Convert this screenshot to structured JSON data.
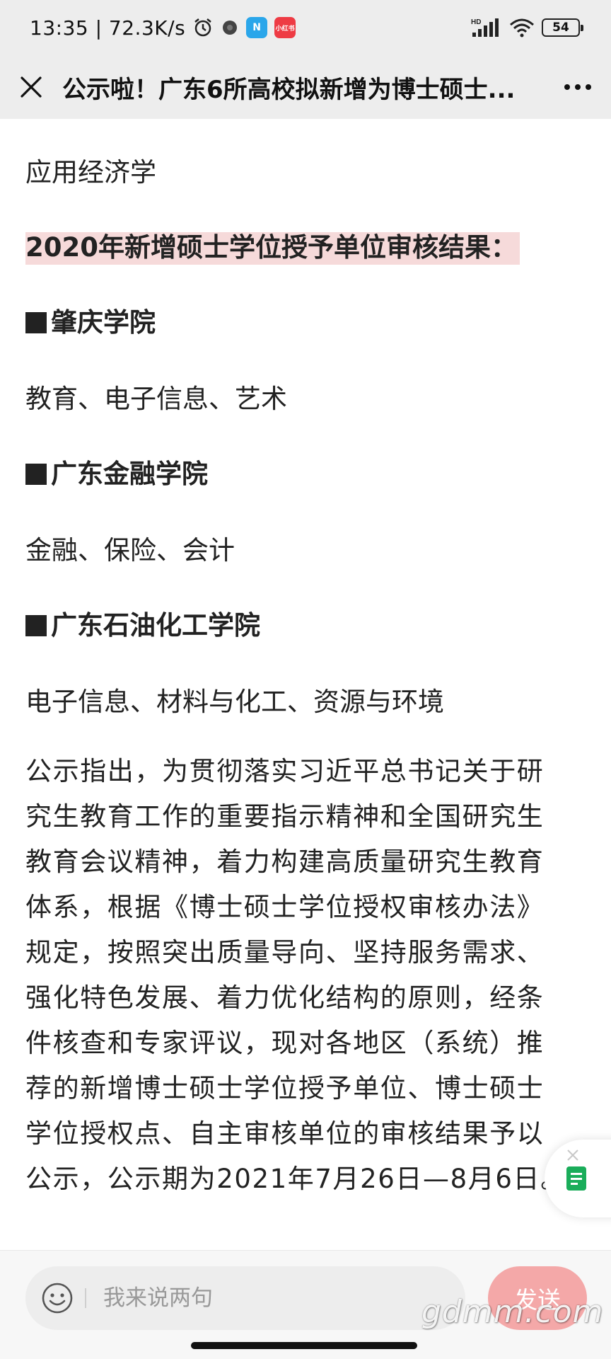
{
  "status_bar": {
    "time_speed": "13:35 | 72.3K/s",
    "app_badges": [
      {
        "label": "N",
        "color": "#2aa6ea"
      },
      {
        "label": "小红书",
        "color": "#ee3b44"
      }
    ],
    "hd_label": "HD",
    "battery": "54"
  },
  "nav": {
    "title": "公示啦！广东6所高校拟新增为博士硕士..."
  },
  "article": {
    "line1": "应用经济学",
    "heading": "2020年新增硕士学位授予单位审核结果：",
    "schools": [
      {
        "name": "肇庆学院",
        "fields": "教育、电子信息、艺术"
      },
      {
        "name": "广东金融学院",
        "fields": "金融、保险、会计"
      },
      {
        "name": "广东石油化工学院",
        "fields": "电子信息、材料与化工、资源与环境"
      }
    ],
    "body_lines": [
      "公示指出，为贯彻落实习近平总书记关于研",
      "究生教育工作的重要指示精神和全国研究生",
      "教育会议精神，着力构建高质量研究生教育",
      "体系，根据《博士硕士学位授权审核办法》",
      "规定，按照突出质量导向、坚持服务需求、",
      "强化特色发展、着力优化结构的原则，经条",
      "件核查和专家评议，现对各地区（系统）推",
      "荐的新增博士硕士学位授予单位、博士硕士",
      "学位授权点、自主审核单位的审核结果予以",
      "公示，公示期为2021年7月26日—8月6日。"
    ]
  },
  "bottom": {
    "placeholder": "我来说两句",
    "send_label": "发送"
  },
  "watermark": "gdmm.com",
  "colors": {
    "bar_bg": "#ededed",
    "highlight": "#f6dada",
    "send": "#f4a8a8",
    "widget_green": "#1aad5a"
  }
}
